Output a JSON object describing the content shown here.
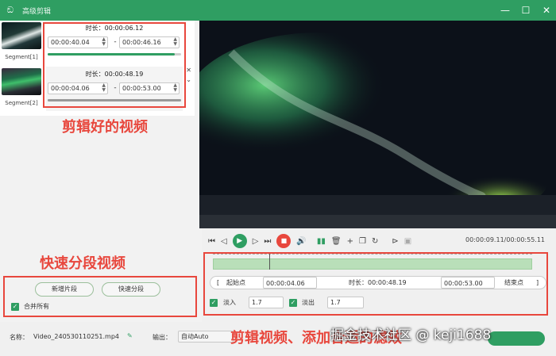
{
  "window": {
    "title": "高级剪辑"
  },
  "segments": [
    {
      "caption": "Segment[1]",
      "duration": "时长：00:00:06.12",
      "start": "00:00:40.04",
      "end": "00:00:46.16",
      "separator": "-",
      "progress": 0.95
    },
    {
      "caption": "Segment[2]",
      "duration": "时长：00:00:48.19",
      "start": "00:00:04.06",
      "end": "00:00:53.00",
      "separator": "-",
      "progress": 1.0
    }
  ],
  "annotations": {
    "clipped_videos": "剪辑好的视频",
    "quick_split": "快速分段视频",
    "edit_video": "剪辑视频、添加合适的滤效"
  },
  "left_actions": {
    "new_segment": "新增片段",
    "quick_split": "快速分段",
    "merge_all": "合并所有"
  },
  "player": {
    "timecode": "00:00:09.11/00:00:55.11"
  },
  "trim": {
    "start_label": "起始点",
    "start_value": "00:00:04.06",
    "duration_label": "时长：00:00:48.19",
    "end_value": "00:00:53.00",
    "end_label": "结束点",
    "fade_in_label": "淡入",
    "fade_in_value": "1.7",
    "fade_out_label": "淡出",
    "fade_out_value": "1.7"
  },
  "footer": {
    "name_label": "名称：",
    "file_name": "Video_240530110251.mp4",
    "output_label": "输出：",
    "output_value": "自动Auto"
  },
  "watermark": "掘金技术社区 @ keji1688",
  "colors": {
    "accent": "#2f9e62",
    "callout": "#e8473d"
  }
}
